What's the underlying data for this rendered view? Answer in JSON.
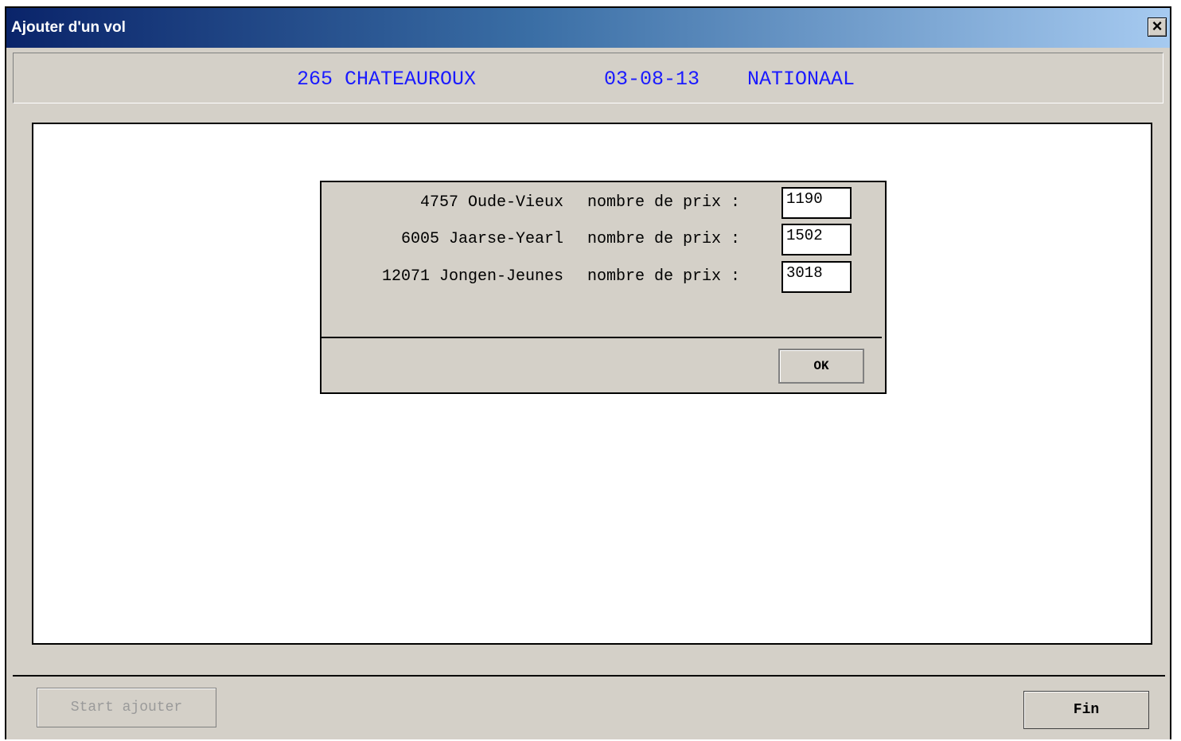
{
  "window": {
    "title": "Ajouter d'un vol",
    "close_label": "×"
  },
  "flight_info": {
    "race": "265 CHATEAUROUX",
    "date": "03-08-13",
    "type": "NATIONAAL"
  },
  "dialog": {
    "rows": [
      {
        "category": "4757 Oude-Vieux",
        "prize_label": "nombre de prix :",
        "value": "1190"
      },
      {
        "category": "6005 Jaarse-Yearl",
        "prize_label": "nombre de prix :",
        "value": "1502"
      },
      {
        "category": "12071 Jongen-Jeunes",
        "prize_label": "nombre de prix :",
        "value": "3018"
      }
    ],
    "ok_label": "OK"
  },
  "buttons": {
    "start_label": "Start ajouter",
    "fin_label": "Fin"
  },
  "colors": {
    "info_text": "#1a1aff",
    "title_gradient_start": "#0a246a",
    "title_gradient_end": "#a6caf0",
    "window_bg": "#d4d0c8"
  }
}
